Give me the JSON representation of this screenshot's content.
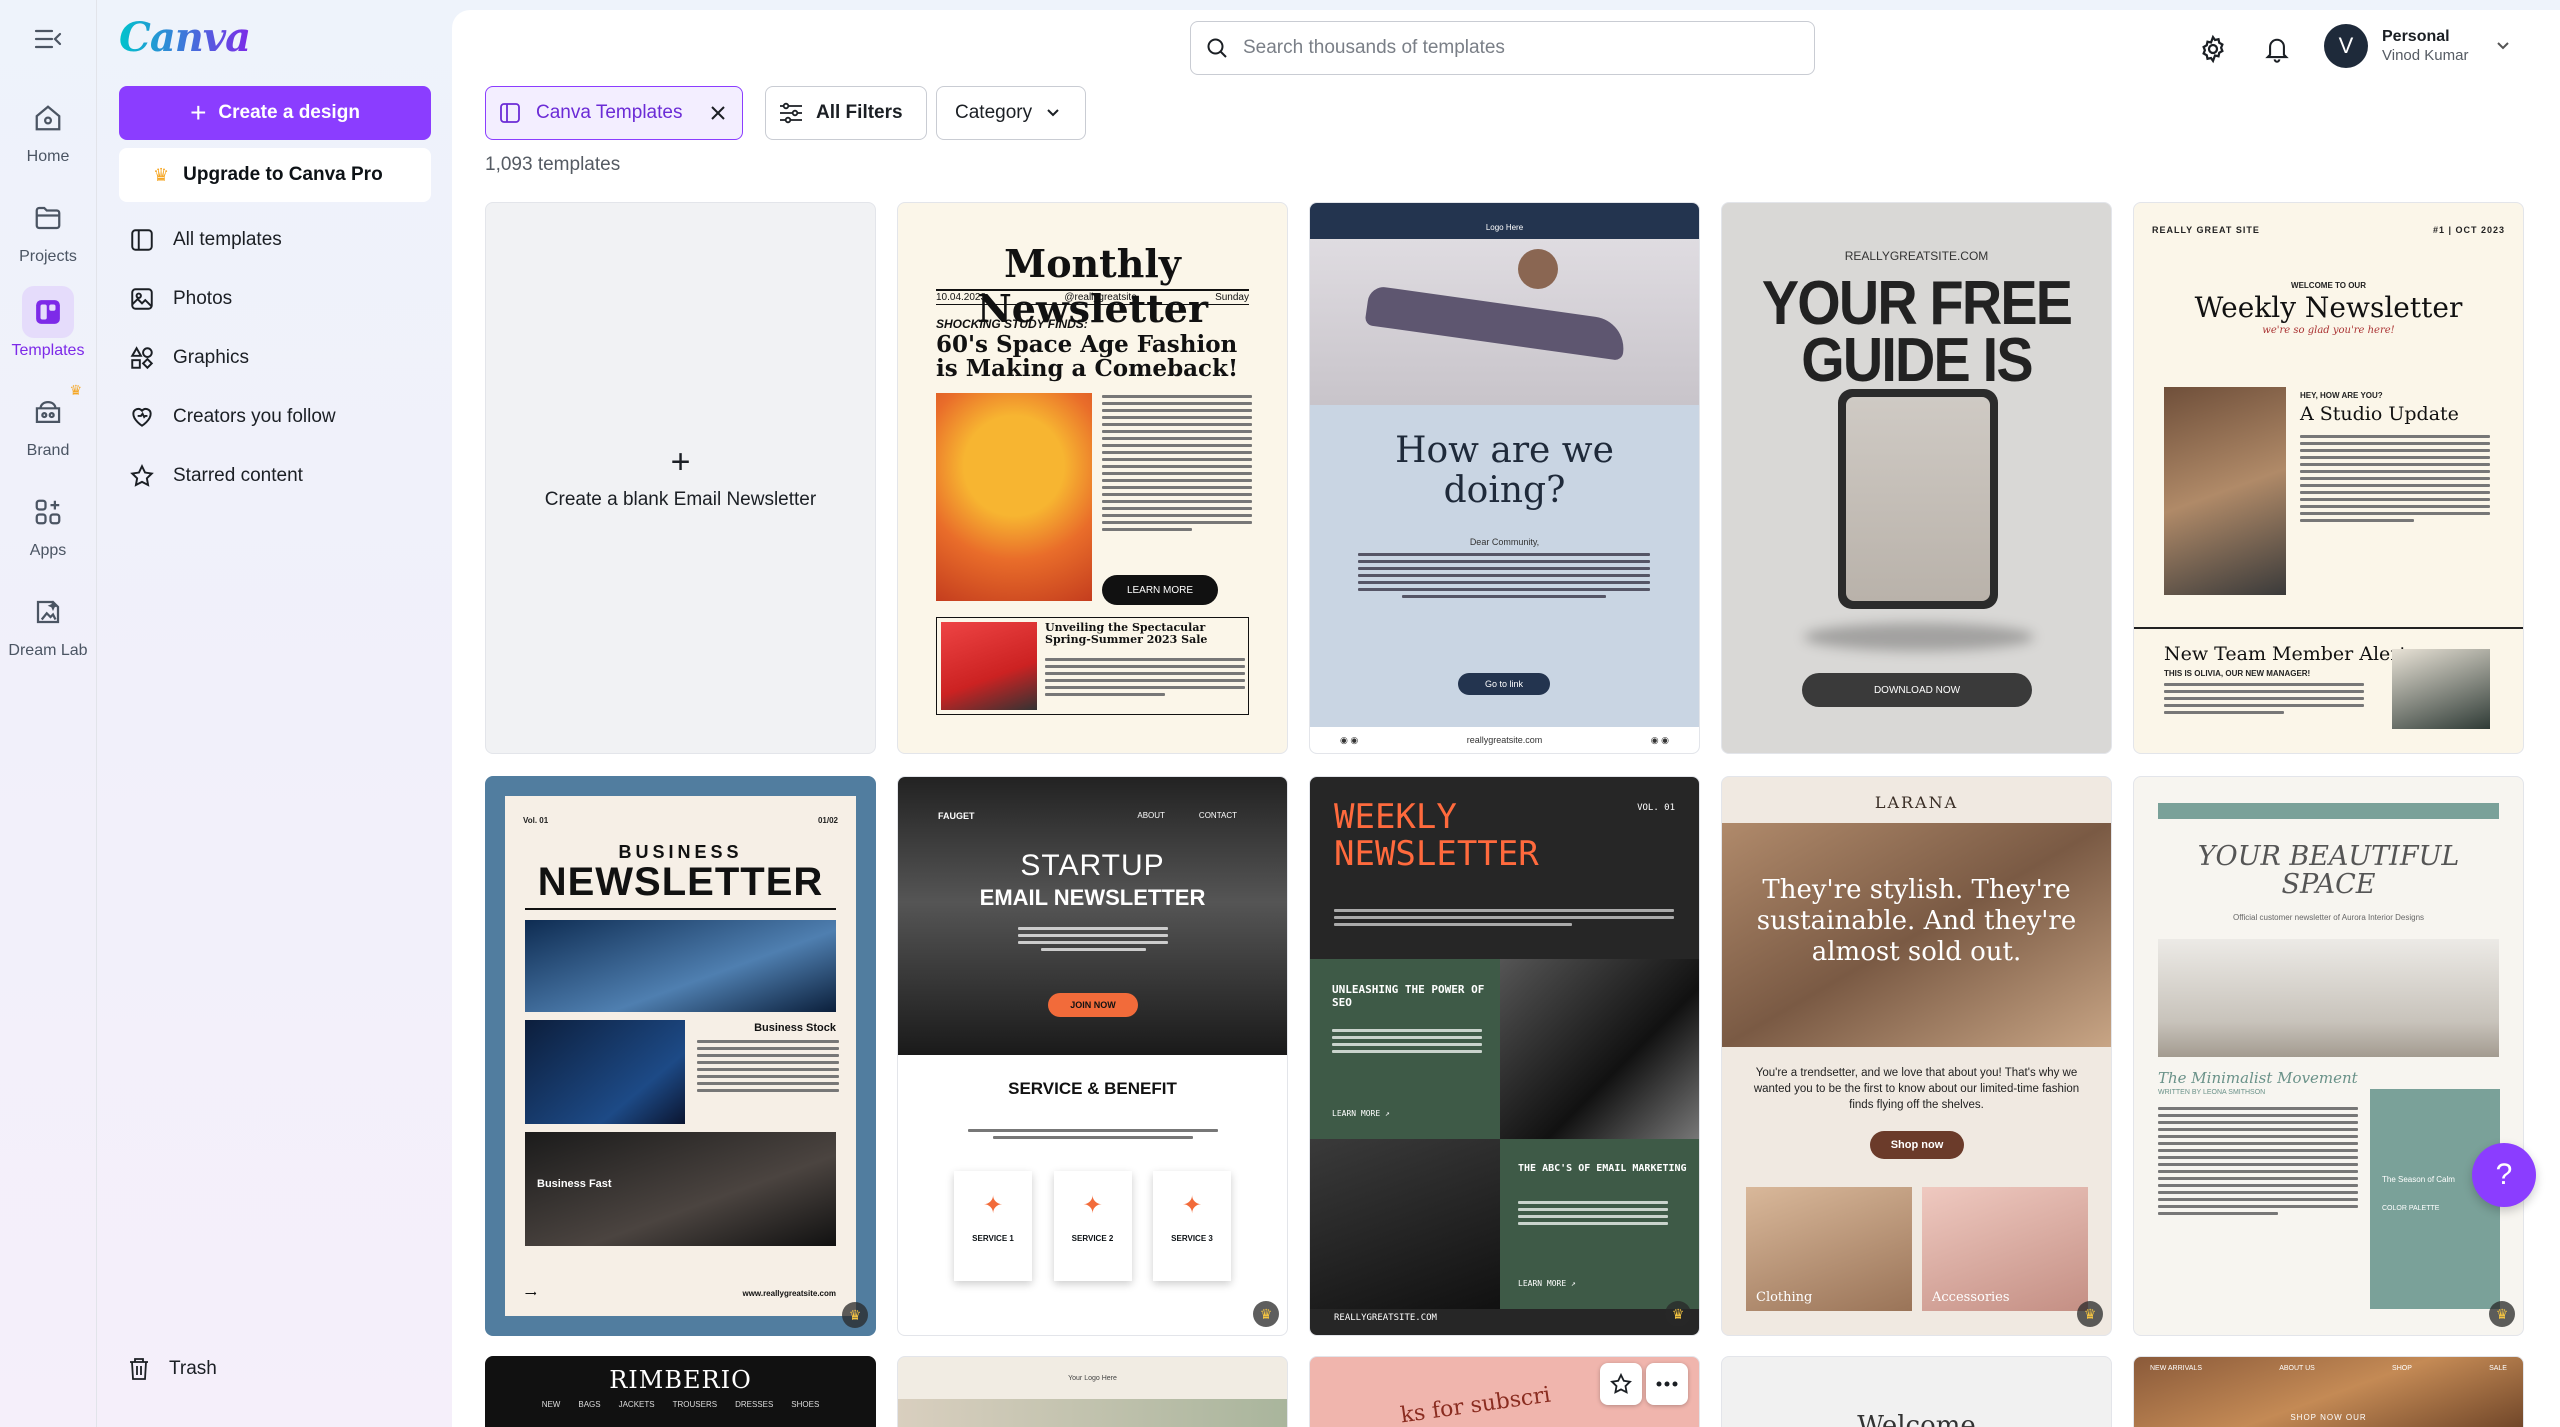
{
  "rail": {
    "items": [
      {
        "label": "Home",
        "icon": "home-icon"
      },
      {
        "label": "Projects",
        "icon": "folder-icon"
      },
      {
        "label": "Templates",
        "icon": "templates-icon"
      },
      {
        "label": "Brand",
        "icon": "brand-icon"
      },
      {
        "label": "Apps",
        "icon": "apps-icon"
      },
      {
        "label": "Dream Lab",
        "icon": "dream-lab-icon"
      }
    ],
    "active": "Templates"
  },
  "side": {
    "logo": "Canva",
    "create_label": "Create a design",
    "upgrade_label": "Upgrade to Canva Pro",
    "nav": [
      {
        "label": "All templates",
        "icon": "all-templates-icon"
      },
      {
        "label": "Photos",
        "icon": "photo-icon"
      },
      {
        "label": "Graphics",
        "icon": "graphics-icon"
      },
      {
        "label": "Creators you follow",
        "icon": "heart-icon"
      },
      {
        "label": "Starred content",
        "icon": "star-icon"
      }
    ],
    "trash_label": "Trash"
  },
  "header": {
    "search_placeholder": "Search thousands of templates",
    "user": {
      "initial": "V",
      "plan": "Personal",
      "name": "Vinod Kumar"
    }
  },
  "filters": {
    "active_chip": "Canva Templates",
    "all_filters": "All Filters",
    "category": "Category",
    "count": "1,093 templates"
  },
  "templates": {
    "blank_label": "Create a blank Email Newsletter",
    "t1": {
      "title": "Monthly Newsletter",
      "date": "10.04.2023",
      "handle": "@reallygreatsite",
      "day": "Sunday",
      "kicker": "SHOCKING STUDY FINDS:",
      "headline": "60's Space Age Fashion is Making a Comeback!",
      "cta": "LEARN MORE",
      "sub": "Unveiling the Spectacular Spring-Summer 2023 Sale"
    },
    "t2": {
      "logo": "Logo Here",
      "headline": "How are we doing?",
      "greeting": "Dear Community,",
      "button": "Go to link",
      "footer": "reallygreatsite.com"
    },
    "t3": {
      "site": "REALLYGREATSITE.COM",
      "headline": "YOUR FREE GUIDE IS HERE",
      "button": "DOWNLOAD NOW"
    },
    "t4": {
      "site": "REALLY GREAT SITE",
      "issue": "#1 | OCT 2023",
      "welcome": "WELCOME TO OUR",
      "title": "Weekly Newsletter",
      "tagline": "we're so glad you're here!",
      "hey": "HEY, HOW ARE YOU?",
      "section": "A Studio Update",
      "alert": "New Team Member Alert",
      "alert_sub": "THIS IS OLIVIA, OUR NEW MANAGER!"
    },
    "t5": {
      "vol": "Vol. 01",
      "num": "01/02",
      "kicker": "BUSINESS",
      "title": "NEWSLETTER",
      "stock": "Business Stock",
      "fast": "Business Fast",
      "site": "www.reallygreatsite.com"
    },
    "t6": {
      "brand": "FAUGET",
      "nav1": "ABOUT",
      "nav2": "CONTACT",
      "title1": "STARTUP",
      "title2": "EMAIL NEWSLETTER",
      "join": "JOIN NOW",
      "section": "SERVICE & BENEFIT",
      "services": [
        "SERVICE 1",
        "SERVICE 2",
        "SERVICE 3"
      ]
    },
    "t7": {
      "title1": "WEEKLY",
      "title2": "NEWSLETTER",
      "vol": "VOL. 01",
      "box1": "UNLEASHING THE POWER OF SEO",
      "learn": "LEARN MORE ↗",
      "box2": "THE ABC'S OF EMAIL MARKETING",
      "footer": "REALLYGREATSITE.COM"
    },
    "t8": {
      "brand": "LARANA",
      "headline": "They're stylish. They're sustainable. And they're almost sold out.",
      "body": "You're a trendsetter, and we love that about you! That's why we wanted you to be the first to know about our limited-time fashion finds flying off the shelves.",
      "button": "Shop now",
      "cat1": "Clothing",
      "cat2": "Accessories"
    },
    "t9": {
      "title": "YOUR BEAUTIFUL SPACE",
      "sub": "Official customer newsletter of Aurora Interior Designs",
      "section": "The Minimalist Movement",
      "byline": "WRITTEN BY LEONA SMITHSON",
      "side": "The Season of Calm",
      "palette": "COLOR PALETTE"
    },
    "row3": {
      "r1": "RIMBERIO",
      "r1_nav": [
        "NEW",
        "BAGS",
        "JACKETS",
        "TROUSERS",
        "DRESSES",
        "SHOES"
      ],
      "r2_logo": "Your Logo Here",
      "r3": "ks for subscri",
      "r4": "Welcome",
      "r5_nav": [
        "NEW ARRIVALS",
        "ABOUT US",
        "SHOP",
        "SALE"
      ],
      "r5_cta": "SHOP NOW OUR"
    }
  },
  "colors": {
    "accent": "#8b3dff",
    "accent_light": "#f3eeff",
    "rail_active_bg": "#e5dcfb",
    "crown": "#f5a623"
  }
}
